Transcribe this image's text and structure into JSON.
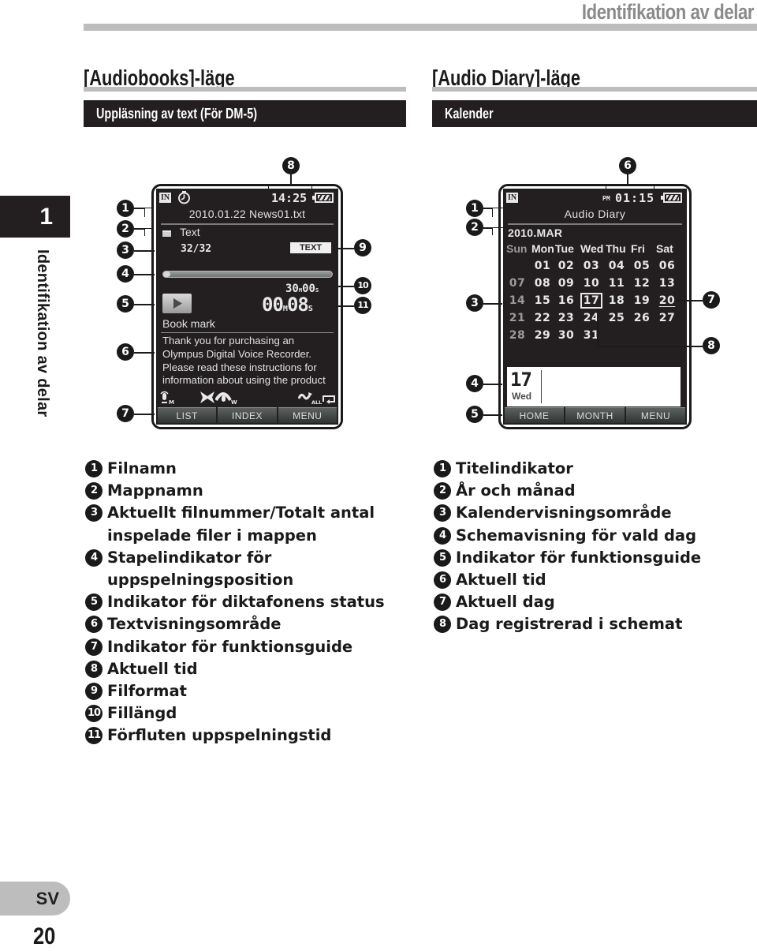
{
  "page": {
    "header_title": "Identifikation av delar",
    "chapter_number": "1",
    "chapter_vertical_title": "Identifikation av delar",
    "language": "SV",
    "page_number": "20"
  },
  "audiobooks": {
    "section_title": "[Audiobooks]-läge",
    "subtitle": "Uppläsning av text (För DM-5)",
    "screen": {
      "in_badge": "IN",
      "timer_icon": "clock-icon",
      "time": "14:25",
      "battery_icon": "battery-icon",
      "filename": "2010.01.22 News01.txt",
      "folder_icon": "folder-icon",
      "folder_name": "Text",
      "file_counter": "32/32",
      "format_badge": "TEXT",
      "progress_fraction": 0.02,
      "file_length": {
        "minutes": "30",
        "seconds": "00",
        "m_unit": "M",
        "s_unit": "S"
      },
      "elapsed": {
        "minutes": "00",
        "seconds": "08",
        "m_unit": "M",
        "s_unit": "S"
      },
      "play_icon": "play-icon",
      "bookmark_label": "Book mark",
      "text_lines": [
        "Thank you for purchasing an",
        "Olympus Digital Voice Recorder.",
        "Please read these instructions for",
        "information about using the product"
      ],
      "status_icons": [
        {
          "name": "mic-sensitivity-icon",
          "suffix": "M"
        },
        {
          "name": "noise-cancel-icon",
          "suffix": ""
        },
        {
          "name": "voice-filter-icon",
          "suffix": "W"
        },
        {
          "name": "repeat-all-icon",
          "suffix": "ALL"
        }
      ],
      "softkeys": [
        "LIST",
        "INDEX",
        "MENU"
      ]
    },
    "callouts": [
      "1",
      "2",
      "3",
      "4",
      "5",
      "6",
      "7",
      "8",
      "9",
      "10",
      "11"
    ],
    "legend": [
      {
        "num": "1",
        "lines": [
          "Filnamn"
        ]
      },
      {
        "num": "2",
        "lines": [
          "Mappnamn"
        ]
      },
      {
        "num": "3",
        "lines": [
          "Aktuellt filnummer/Totalt antal",
          "inspelade filer i mappen"
        ]
      },
      {
        "num": "4",
        "lines": [
          "Stapelindikator för",
          "uppspelningsposition"
        ]
      },
      {
        "num": "5",
        "lines": [
          "Indikator för diktafonens status"
        ]
      },
      {
        "num": "6",
        "lines": [
          "Textvisningsområde"
        ]
      },
      {
        "num": "7",
        "lines": [
          "Indikator för funktionsguide"
        ]
      },
      {
        "num": "8",
        "lines": [
          "Aktuell tid"
        ]
      },
      {
        "num": "9",
        "lines": [
          "Filformat"
        ]
      },
      {
        "num": "10",
        "lines": [
          "Fillängd"
        ]
      },
      {
        "num": "11",
        "lines": [
          "Förfluten uppspelningstid"
        ]
      }
    ]
  },
  "audio_diary": {
    "section_title": "[Audio Diary]-läge",
    "subtitle": "Kalender",
    "screen": {
      "in_badge": "IN",
      "ampm": "PM",
      "time": "01:15",
      "battery_icon": "battery-icon",
      "title": "Audio Diary",
      "year_month": "2010.MAR",
      "weekdays": [
        "Sun",
        "Mon",
        "Tue",
        "Wed",
        "Thu",
        "Fri",
        "Sat"
      ],
      "weeks": [
        [
          "",
          "01",
          "02",
          "03",
          "04",
          "05",
          "06"
        ],
        [
          "07",
          "08",
          "09",
          "10",
          "11",
          "12",
          "13"
        ],
        [
          "14",
          "15",
          "16",
          "17",
          "18",
          "19",
          "20"
        ],
        [
          "21",
          "22",
          "23",
          "24",
          "25",
          "26",
          "27"
        ],
        [
          "28",
          "29",
          "30",
          "31",
          "",
          "",
          ""
        ]
      ],
      "selected_day": "17",
      "current_day": "20",
      "scheduled_days": [
        "24",
        "31"
      ],
      "schedule_day_number": "17",
      "schedule_weekday": "Wed",
      "softkeys": [
        "HOME",
        "MONTH",
        "MENU"
      ]
    },
    "callouts": [
      "1",
      "2",
      "3",
      "4",
      "5",
      "6",
      "7",
      "8"
    ],
    "legend": [
      {
        "num": "1",
        "lines": [
          "Titelindikator"
        ]
      },
      {
        "num": "2",
        "lines": [
          "År och månad"
        ]
      },
      {
        "num": "3",
        "lines": [
          "Kalendervisningsområde"
        ]
      },
      {
        "num": "4",
        "lines": [
          "Schemavisning för vald dag"
        ]
      },
      {
        "num": "5",
        "lines": [
          "Indikator för funktionsguide"
        ]
      },
      {
        "num": "6",
        "lines": [
          "Aktuell tid"
        ]
      },
      {
        "num": "7",
        "lines": [
          "Aktuell dag"
        ]
      },
      {
        "num": "8",
        "lines": [
          "Dag registrerad i schemat"
        ]
      }
    ]
  }
}
